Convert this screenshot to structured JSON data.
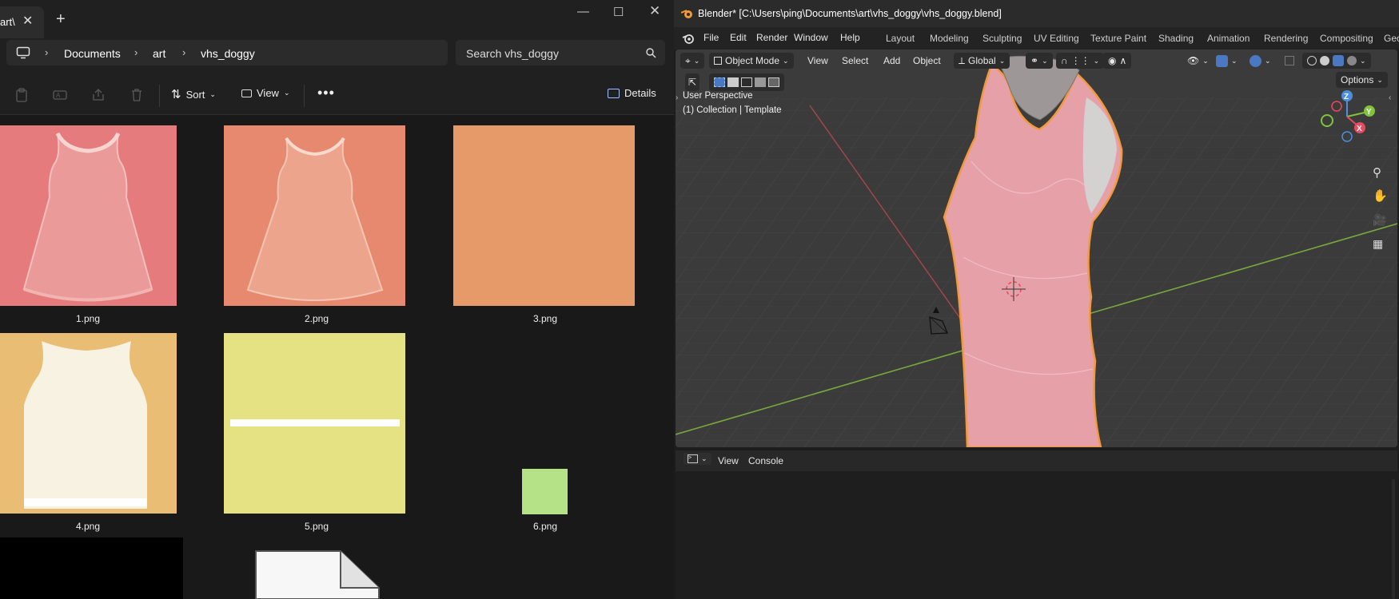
{
  "explorer": {
    "tab_title": "art\\",
    "address": {
      "crumbs": [
        "Documents",
        "art",
        "vhs_doggy"
      ]
    },
    "search": {
      "placeholder": "Search vhs_doggy"
    },
    "toolbar": {
      "sort_label": "Sort",
      "view_label": "View",
      "details_label": "Details"
    },
    "files": [
      {
        "name": "1.png",
        "color": "#e57b7d"
      },
      {
        "name": "2.png",
        "color": "#e7896f"
      },
      {
        "name": "3.png",
        "color": "#e69a69"
      },
      {
        "name": "4.png",
        "color": "#e9be74"
      },
      {
        "name": "5.png",
        "color": "#e4e283"
      },
      {
        "name": "6.png",
        "color": "#b5e286"
      }
    ]
  },
  "blender": {
    "title": "Blender* [C:\\Users\\ping\\Documents\\art\\vhs_doggy\\vhs_doggy.blend]",
    "menu": [
      "File",
      "Edit",
      "Render",
      "Window",
      "Help"
    ],
    "workspaces": [
      "Layout",
      "Modeling",
      "Sculpting",
      "UV Editing",
      "Texture Paint",
      "Shading",
      "Animation",
      "Rendering",
      "Compositing",
      "Geo"
    ],
    "viewport": {
      "mode": "Object Mode",
      "menus": [
        "View",
        "Select",
        "Add",
        "Object"
      ],
      "transform_orientation": "Global",
      "options_label": "Options",
      "perspective_label": "User Perspective",
      "collection_label": "(1) Collection | Template",
      "axes": [
        "Z",
        "Y",
        "X"
      ]
    },
    "console": {
      "menus": [
        "View",
        "Console"
      ]
    },
    "colors": {
      "accent_orange": "#f29a3a",
      "axis_x": "#e84a5f",
      "axis_y": "#7fc43a",
      "axis_z": "#4a8fe0"
    }
  }
}
